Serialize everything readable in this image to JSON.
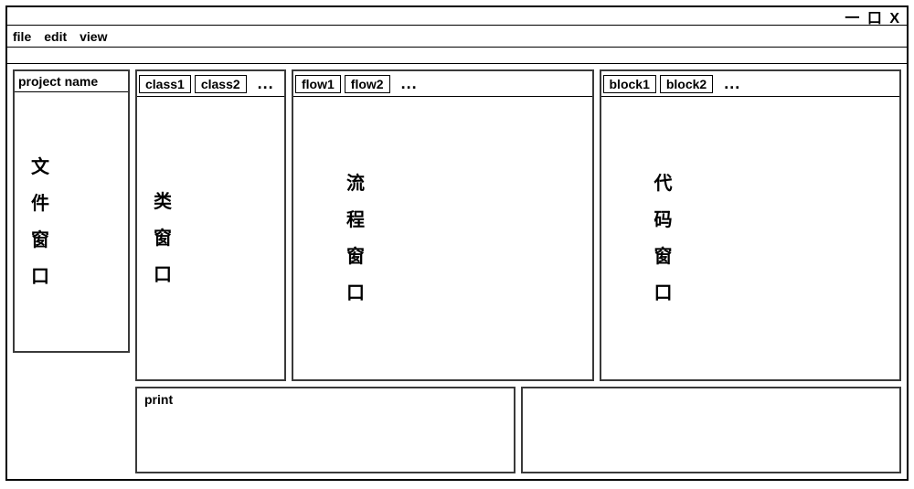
{
  "window": {
    "controls": "一 口 X"
  },
  "menu": {
    "file": "file",
    "edit": "edit",
    "view": "view"
  },
  "project": {
    "header": "project name",
    "body_chars": [
      "文",
      "件",
      "窗",
      "口"
    ]
  },
  "class_panel": {
    "tabs": [
      "class1",
      "class2"
    ],
    "more": "...",
    "body_chars": [
      "类",
      "窗",
      "口"
    ]
  },
  "flow_panel": {
    "tabs": [
      "flow1",
      "flow2"
    ],
    "more": "...",
    "body_chars": [
      "流",
      "程",
      "窗",
      "口"
    ]
  },
  "block_panel": {
    "tabs": [
      "block1",
      "block2"
    ],
    "more": "...",
    "body_chars": [
      "代",
      "码",
      "窗",
      "口"
    ]
  },
  "print_panel": {
    "label": "print"
  }
}
